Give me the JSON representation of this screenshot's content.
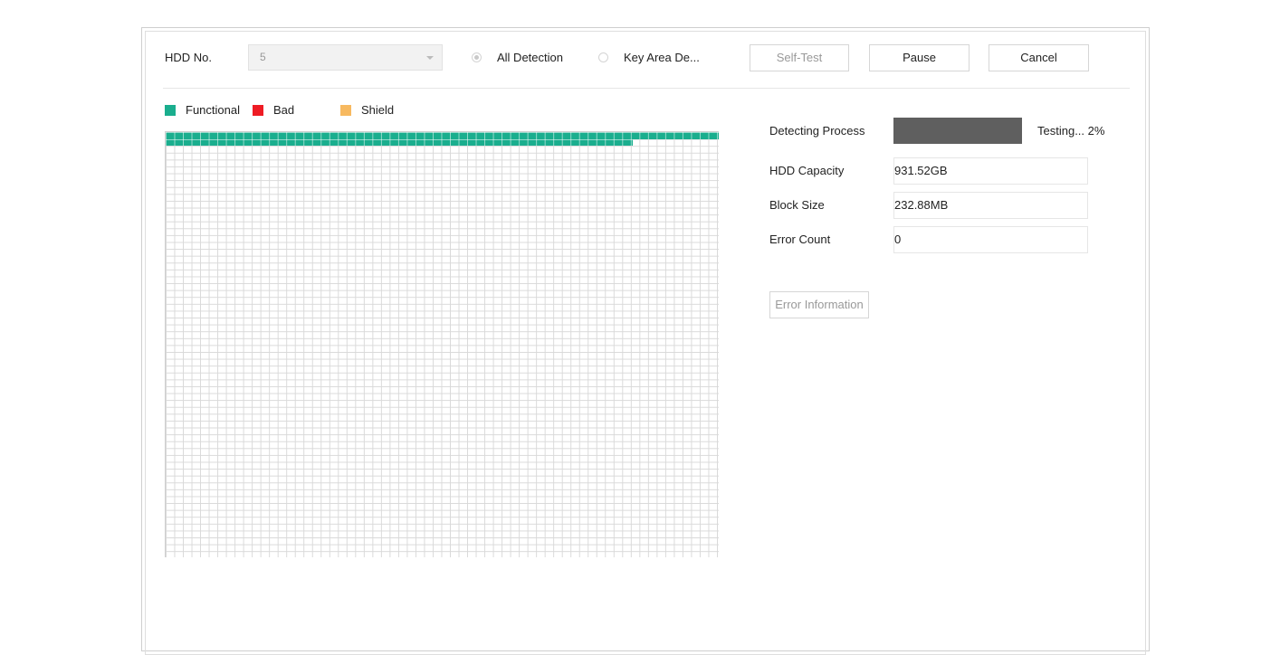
{
  "header": {
    "hdd_no_label": "HDD No.",
    "hdd_no_value": "5",
    "radio_all_label": "All Detection",
    "radio_key_label": "Key Area De...",
    "selftest_label": "Self-Test",
    "pause_label": "Pause",
    "cancel_label": "Cancel"
  },
  "legend": {
    "functional_label": "Functional",
    "bad_label": "Bad",
    "shield_label": "Shield",
    "colors": {
      "functional": "#1aae8e",
      "bad": "#ee1c24",
      "shield": "#f7b960"
    }
  },
  "grid": {
    "columns": 64,
    "rows": 62,
    "functional_full_rows": 1,
    "functional_partial_row_cells": 54
  },
  "info": {
    "detecting_label": "Detecting Process",
    "progress_text": "Testing... 2%",
    "progress_percent": 2,
    "capacity_label": "HDD Capacity",
    "capacity_value": "931.52GB",
    "block_label": "Block Size",
    "block_value": "232.88MB",
    "error_label": "Error Count",
    "error_value": "0",
    "error_info_label": "Error Information"
  }
}
